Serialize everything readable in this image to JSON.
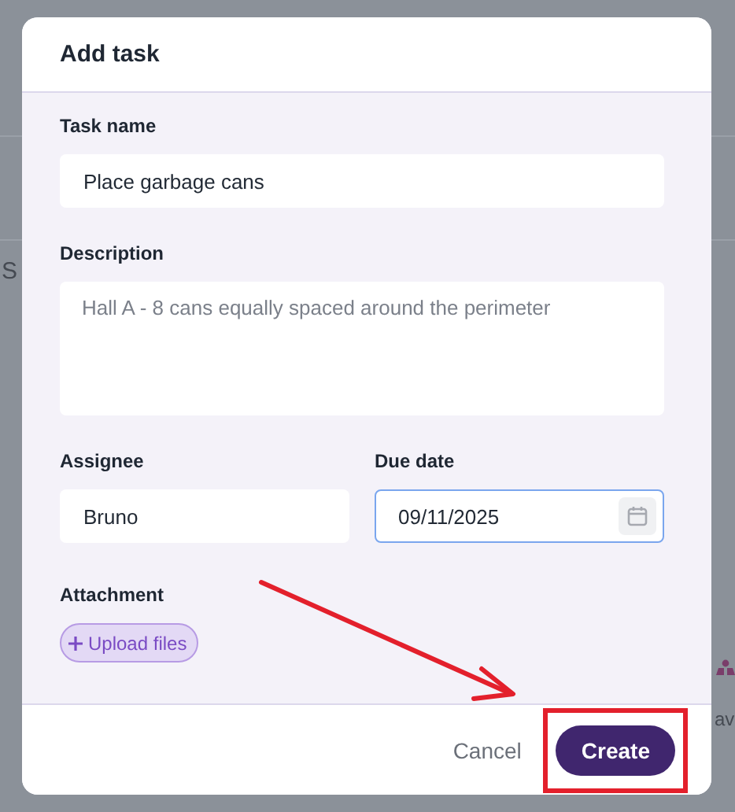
{
  "background": {
    "left_text": "S",
    "right_text": "av"
  },
  "dialog": {
    "title": "Add task",
    "task_name": {
      "label": "Task name",
      "value": "Place garbage cans"
    },
    "description": {
      "label": "Description",
      "placeholder": "Hall A - 8 cans equally spaced around the perimeter"
    },
    "assignee": {
      "label": "Assignee",
      "value": "Bruno",
      "focused": false
    },
    "due_date": {
      "label": "Due date",
      "value": "09/11/2025",
      "focused": true
    },
    "attachment": {
      "label": "Attachment",
      "button": "Upload files"
    },
    "buttons": [
      {
        "label": "Cancel",
        "kind": "secondary",
        "highlighted": false
      },
      {
        "label": "Create",
        "kind": "primary",
        "highlighted": true
      }
    ]
  }
}
